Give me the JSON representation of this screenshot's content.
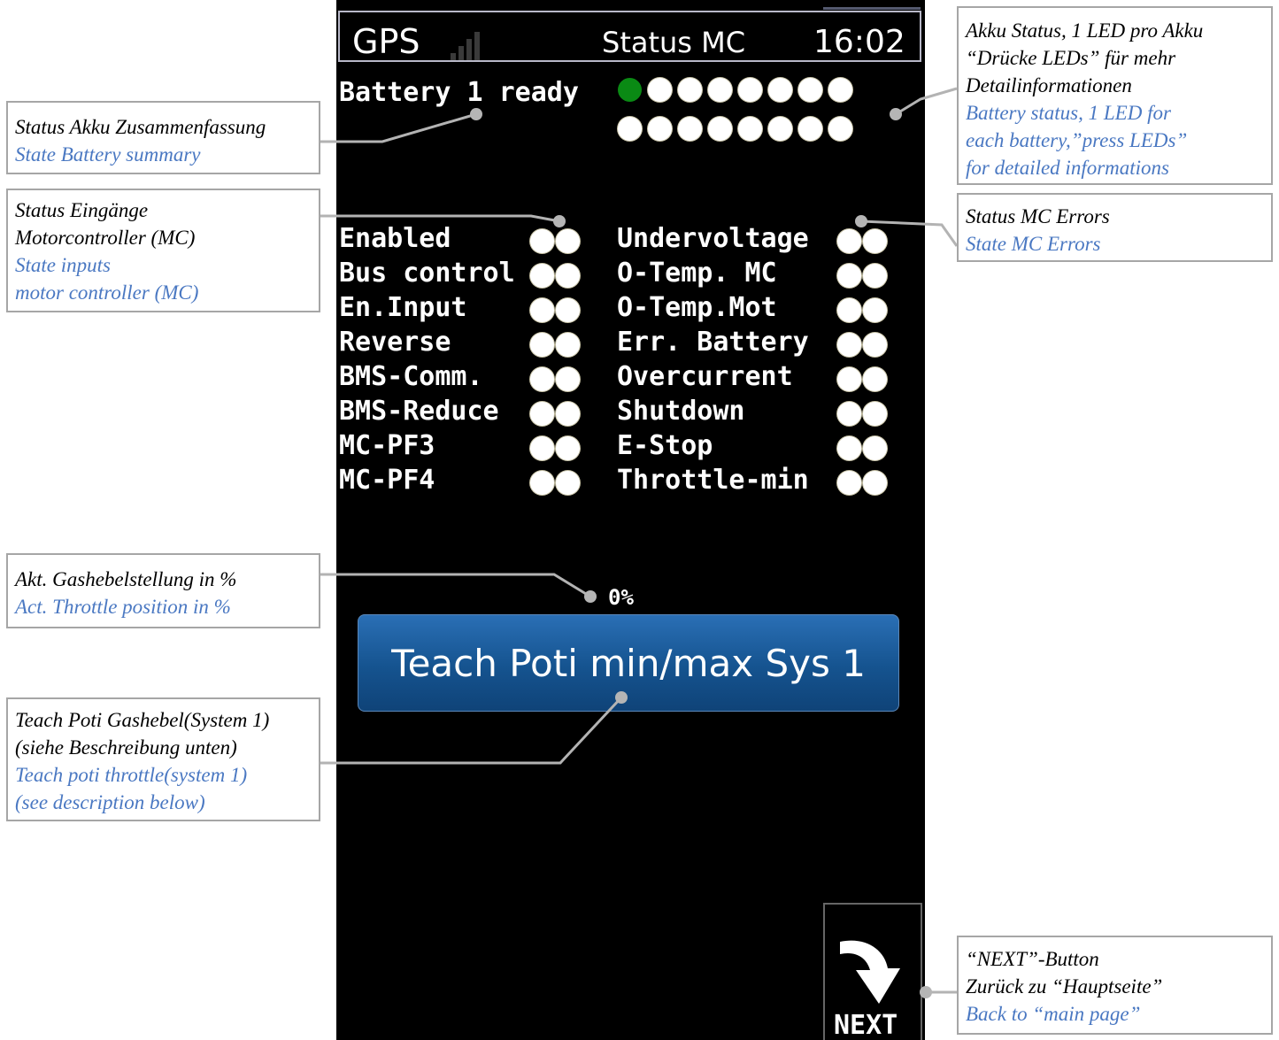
{
  "screen": {
    "header": {
      "gps_label": "GPS",
      "title": "Status MC",
      "clock": "16:02"
    },
    "battery": {
      "summary": "Battery 1 ready",
      "led_count": 16,
      "green_led_index": 0,
      "colors": {
        "ok": "#0a8a14",
        "off": "#ffffff"
      }
    },
    "inputs": [
      "Enabled",
      "Bus control",
      "En.Input",
      "Reverse",
      "BMS-Comm.",
      "BMS-Reduce",
      "MC-PF3",
      "MC-PF4"
    ],
    "errors": [
      "Undervoltage",
      "O-Temp. MC",
      "O-Temp.Mot",
      "Err. Battery",
      "Overcurrent",
      "Shutdown",
      "E-Stop",
      "Throttle-min"
    ],
    "throttle_value": "0%",
    "teach_button": "Teach Poti min/max Sys 1",
    "next_button": "NEXT",
    "accent_color": "#1b5da0"
  },
  "annotations": {
    "battery_summary": {
      "de": "Status Akku Zusammenfassung",
      "en": "State Battery summary"
    },
    "inputs": {
      "de1": "Status Eingänge",
      "de2": "Motorcontroller (MC)",
      "en1": "State inputs",
      "en2": "motor controller (MC)"
    },
    "throttle": {
      "de": "Akt. Gashebelstellung in %",
      "en": "Act. Throttle position in %"
    },
    "teach": {
      "de1": "Teach Poti Gashebel(System 1)",
      "de2": "(siehe Beschreibung unten)",
      "en1": "Teach poti throttle(system 1)",
      "en2": "(see description below)"
    },
    "akku_status": {
      "de1": "Akku Status, 1 LED pro Akku",
      "de2": "“Drücke LEDs” für mehr",
      "de3": "Detailinformationen",
      "en1": "Battery status, 1 LED for",
      "en2": "each battery,”press LEDs”",
      "en3": "for detailed informations"
    },
    "mc_errors": {
      "de": "Status MC Errors",
      "en": "State MC Errors"
    },
    "next": {
      "de1": "“NEXT”-Button",
      "de2": "Zurück zu “Hauptseite”",
      "en": "Back to “main page”"
    }
  }
}
